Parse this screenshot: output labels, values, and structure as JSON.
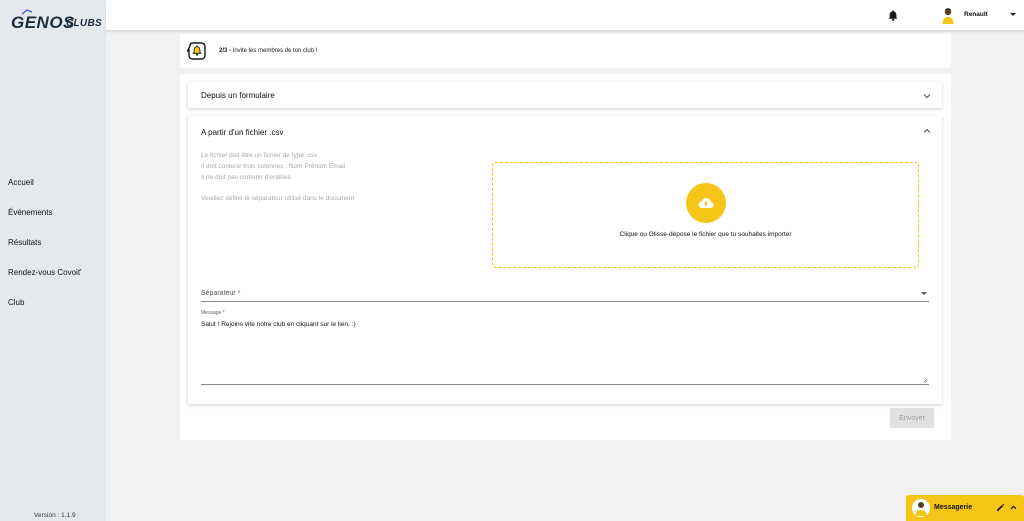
{
  "sidebar": {
    "logo_main": "GENOS",
    "logo_sub": "CLUBS",
    "items": [
      {
        "label": "Accueil"
      },
      {
        "label": "Événements"
      },
      {
        "label": "Résultats"
      },
      {
        "label": "Rendez-vous Covoit'"
      },
      {
        "label": "Club"
      }
    ],
    "version": "Version : 1.1.9"
  },
  "header": {
    "username": "Renault"
  },
  "step": {
    "number": "2/3 -",
    "text": " Invite les membres de ton club !"
  },
  "panels": {
    "form_title": "Depuis un formulaire",
    "csv_title": "A partir d'un fichier .csv",
    "help_lines": [
      "Le fichier doit être un fichier de type .csv",
      "Il doit contenir trois colonnes : Nom Prénom Email",
      "Il ne doit pas contenir d'entêtes"
    ],
    "separator_help": "Veuillez définir le séparateur utilisé dans le document",
    "dropzone_text": "Clique ou Glisse-dépose le fichier que tu souhaites importer",
    "separator_label": "Séparateur *",
    "message_label": "Message *",
    "message_value": "Salut ! Rejoins vite notre club en cliquant sur le lien. :)",
    "send_label": "Envoyer"
  },
  "messaging": {
    "title": "Messagerie"
  },
  "colors": {
    "accent": "#f5c518",
    "sidebar_bg": "#e6e9ec",
    "page_bg": "#f1f1f1"
  }
}
